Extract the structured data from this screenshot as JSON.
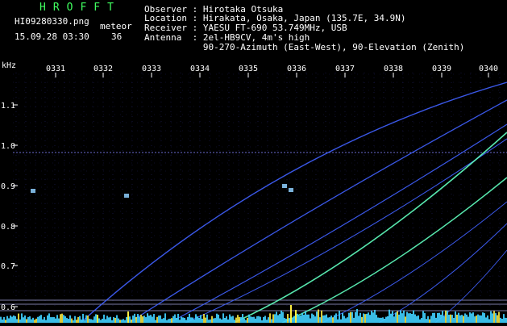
{
  "header": {
    "logo": "HROFFT",
    "filename": "HI09280330.png",
    "datetime": "15.09.28 03:30",
    "count_label": "meteor",
    "count_value": "36"
  },
  "station": {
    "observer": "Observer : Hirotaka Otsuka",
    "location": "Location : Hirakata, Osaka, Japan (135.7E, 34.9N)",
    "receiver": "Receiver : YAESU FT-690 53.749MHz, USB",
    "antenna": "Antenna  : 2el-HB9CV, 4m's high",
    "antenna_detail": "           90-270-Azimuth (East-West), 90-Elevation (Zenith)"
  },
  "plot": {
    "y_unit": "kHz",
    "y_ticks": [
      "1.1",
      "1.0",
      "0.9",
      "0.8",
      "0.7",
      "0.6"
    ],
    "x_ticks": [
      "0331",
      "0332",
      "0333",
      "0334",
      "0335",
      "0336",
      "0337",
      "0338",
      "0339",
      "0340"
    ],
    "colors": {
      "background": "#000000",
      "grid": "#3a3ab0",
      "trace": "#4060ff",
      "trace_bright": "#60ffc0",
      "noise": "#40d0ff",
      "axis_text": "#ffffff"
    }
  }
}
